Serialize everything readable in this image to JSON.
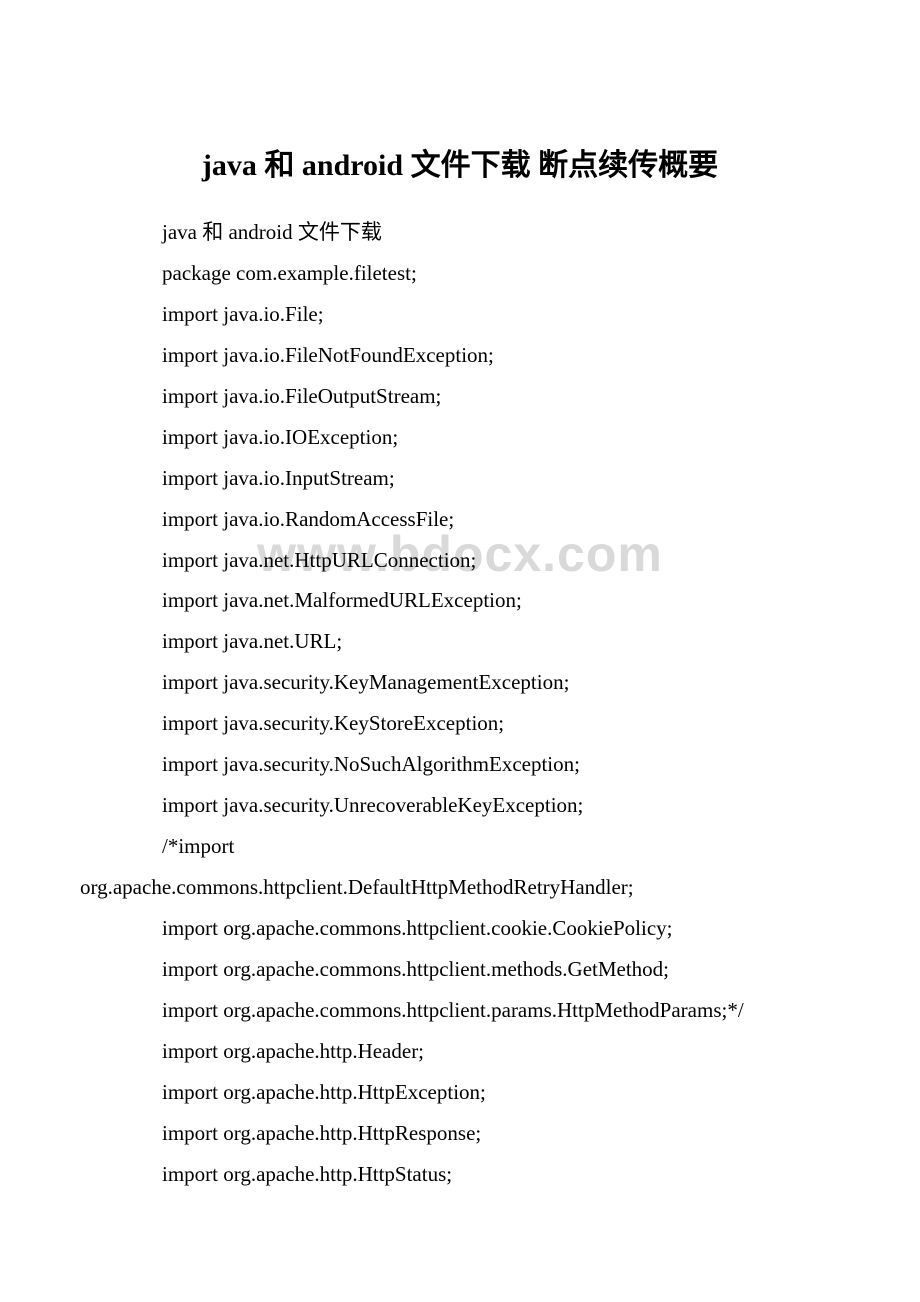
{
  "watermark": "www.bdocx.com",
  "title": "java 和 android 文件下载 断点续传概要",
  "lines": [
    {
      "text": "java 和 android 文件下载",
      "indent": true
    },
    {
      "text": "package com.example.filetest;",
      "indent": true
    },
    {
      "text": "import java.io.File;",
      "indent": true
    },
    {
      "text": "import java.io.FileNotFoundException;",
      "indent": true
    },
    {
      "text": "import java.io.FileOutputStream;",
      "indent": true
    },
    {
      "text": "import java.io.IOException;",
      "indent": true
    },
    {
      "text": "import java.io.InputStream;",
      "indent": true
    },
    {
      "text": "import java.io.RandomAccessFile;",
      "indent": true
    },
    {
      "text": "import java.net.HttpURLConnection;",
      "indent": true
    },
    {
      "text": "import java.net.MalformedURLException;",
      "indent": true
    },
    {
      "text": "import java.net.URL;",
      "indent": true
    },
    {
      "text": "import java.security.KeyManagementException;",
      "indent": true
    },
    {
      "text": "import java.security.KeyStoreException;",
      "indent": true
    },
    {
      "text": "import java.security.NoSuchAlgorithmException;",
      "indent": true
    },
    {
      "text": "import java.security.UnrecoverableKeyException;",
      "indent": true
    },
    {
      "text": "/*import",
      "indent": true
    },
    {
      "text": "org.apache.commons.httpclient.DefaultHttpMethodRetryHandler;",
      "indent": false
    },
    {
      "text": "import org.apache.commons.httpclient.cookie.CookiePolicy;",
      "indent": true
    },
    {
      "text": "import org.apache.commons.httpclient.methods.GetMethod;",
      "indent": true
    },
    {
      "text": "import org.apache.commons.httpclient.params.HttpMethodParams;*/",
      "indent": true
    },
    {
      "text": "import org.apache.http.Header;",
      "indent": true
    },
    {
      "text": "import org.apache.http.HttpException;",
      "indent": true
    },
    {
      "text": "import org.apache.http.HttpResponse;",
      "indent": true
    },
    {
      "text": "import org.apache.http.HttpStatus;",
      "indent": true
    }
  ]
}
